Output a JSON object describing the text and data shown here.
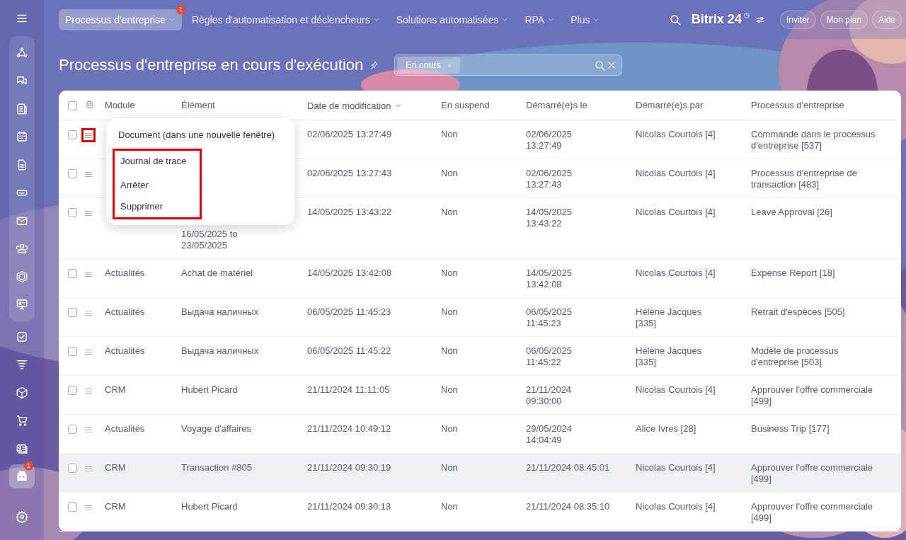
{
  "top_nav": {
    "items": [
      {
        "label": "Processus d'entreprise",
        "selected": true,
        "badge": "1"
      },
      {
        "label": "Règles d'automatisation et déclencheurs",
        "selected": false
      },
      {
        "label": "Solutions automatisées",
        "selected": false
      },
      {
        "label": "RPA",
        "selected": false
      },
      {
        "label": "Plus",
        "selected": false
      }
    ],
    "logo": "Bitrix 24",
    "buttons": [
      "Inviter",
      "Mon plan",
      "Aide"
    ]
  },
  "sidebar": {
    "badge": "1"
  },
  "page_title": "Processus d'entreprise en cours d'exécution",
  "filter": {
    "chips": [
      "En cours"
    ]
  },
  "table": {
    "all_checked": false,
    "columns": [
      {
        "label": "Module",
        "sorted": false
      },
      {
        "label": "Élément",
        "sorted": false
      },
      {
        "label": "Date de modification",
        "sorted": true
      },
      {
        "label": "En suspend",
        "sorted": false
      },
      {
        "label": "Démarré(e)s le",
        "sorted": false
      },
      {
        "label": "Démarré(e)s par",
        "sorted": false
      },
      {
        "label": "Processus d'entreprise",
        "sorted": false
      }
    ],
    "rows": [
      {
        "checked": false,
        "hovered": false,
        "menu_highlighted": true,
        "date": "02/06/2025 13:27:49",
        "suspend": "Non",
        "started": "02/06/2025\n13:27:49",
        "by": "Nicolas Courtois [4]",
        "process": "Commande dans le processus\nd'entreprise [537]"
      },
      {
        "checked": false,
        "hovered": false,
        "menu_highlighted": false,
        "date": "02/06/2025 13:27:43",
        "suspend": "Non",
        "started": "02/06/2025\n13:27:43",
        "by": "Nicolas Courtois [4]",
        "process": "Processus d'entreprise de\ntransaction [483]"
      },
      {
        "checked": false,
        "hovered": false,
        "menu_highlighted": false,
        "element": "16/05/2025 to\n23/05/2025",
        "element_covered": true,
        "date": "14/05/2025 13:43:22",
        "suspend": "Non",
        "started": "14/05/2025\n13:43:22",
        "by": "Nicolas Courtois [4]",
        "process": "Leave Approval [26]"
      },
      {
        "checked": false,
        "hovered": false,
        "menu_highlighted": false,
        "module": "Actualités",
        "element": "Achat de matériel",
        "date": "14/05/2025 13:42:08",
        "suspend": "Non",
        "started": "14/05/2025\n13:42:08",
        "by": "Nicolas Courtois [4]",
        "process": "Expense Report [18]"
      },
      {
        "checked": false,
        "hovered": false,
        "menu_highlighted": false,
        "module": "Actualités",
        "element": "Выдача наличных",
        "date": "06/05/2025 11:45:23",
        "suspend": "Non",
        "started": "06/05/2025\n11:45:23",
        "by": "Hélène Jacques\n[335]",
        "process": "Retrait d'espèces [505]"
      },
      {
        "checked": false,
        "hovered": false,
        "menu_highlighted": false,
        "module": "Actualités",
        "element": "Выдача наличных",
        "date": "06/05/2025 11:45:22",
        "suspend": "Non",
        "started": "06/05/2025\n11:45:22",
        "by": "Hélène Jacques\n[335]",
        "process": "Modèle de processus\nd'entreprise [503]"
      },
      {
        "checked": false,
        "hovered": false,
        "menu_highlighted": false,
        "module": "CRM",
        "element": "Hubert Picard",
        "date": "21/11/2024 11:11:05",
        "suspend": "Non",
        "started": "21/11/2024\n09:30:00",
        "by": "Nicolas Courtois [4]",
        "process": "Approuver l'offre commerciale\n[499]"
      },
      {
        "checked": false,
        "hovered": false,
        "menu_highlighted": false,
        "module": "Actualités",
        "element": "Voyage d'affaires",
        "date": "21/11/2024 10:49:12",
        "suspend": "Non",
        "started": "29/05/2024\n14:04:49",
        "by": "Alice Ivres [28]",
        "process": "Business Trip [177]"
      },
      {
        "checked": false,
        "hovered": true,
        "menu_highlighted": false,
        "module": "CRM",
        "element": "Transaction #805",
        "date": "21/11/2024 09:30:19",
        "suspend": "Non",
        "started": "21/11/2024 08:45:01",
        "by": "Nicolas Courtois [4]",
        "process": "Approuver l'offre commerciale\n[499]"
      },
      {
        "checked": false,
        "hovered": false,
        "menu_highlighted": false,
        "module": "CRM",
        "element": "Hubert Picard",
        "date": "21/11/2024 09:30:13",
        "suspend": "Non",
        "started": "21/11/2024 08:35:10",
        "by": "Nicolas Courtois [4]",
        "process": "Approuver l'offre commerciale\n[499]"
      }
    ]
  },
  "context_menu": {
    "items": [
      {
        "label": "Document (dans une nouvelle fenêtre)",
        "highlighted": false
      },
      {
        "label": "Journal de trace",
        "highlighted": true
      },
      {
        "label": "Arrêter",
        "highlighted": true
      },
      {
        "label": "Supprimer",
        "highlighted": true
      }
    ]
  }
}
